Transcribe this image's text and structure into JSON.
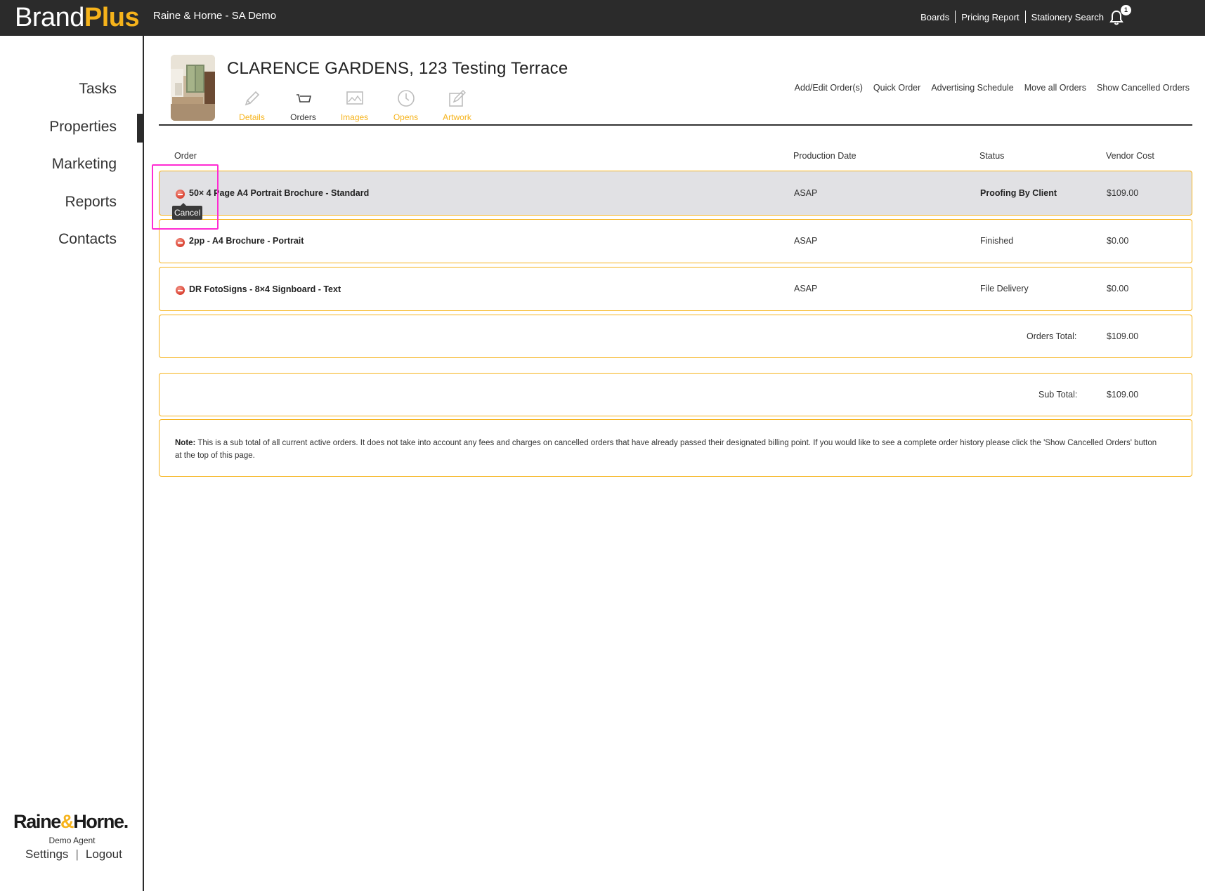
{
  "topbar": {
    "brand_part1": "Brand",
    "brand_part2": "Plus",
    "account": "Raine & Horne - SA Demo",
    "links": [
      "Boards",
      "Pricing Report",
      "Stationery Search"
    ],
    "notification_count": "1"
  },
  "sidebar": {
    "items": [
      "Tasks",
      "Properties",
      "Marketing",
      "Reports",
      "Contacts"
    ],
    "active_item": "Properties",
    "logo_part1": "Raine",
    "logo_amp": "&",
    "logo_part2": "Horne",
    "logo_dot": ".",
    "agent": "Demo Agent",
    "settings": "Settings",
    "separator": "|",
    "logout": "Logout"
  },
  "property": {
    "title": "CLARENCE GARDENS, 123 Testing Terrace",
    "tabs": [
      {
        "label": "Details",
        "icon": "pencil-icon"
      },
      {
        "label": "Orders",
        "icon": "cart-icon"
      },
      {
        "label": "Images",
        "icon": "image-icon"
      },
      {
        "label": "Opens",
        "icon": "clock-icon"
      },
      {
        "label": "Artwork",
        "icon": "artwork-icon"
      }
    ],
    "active_tab": "Orders",
    "actions": [
      "Add/Edit Order(s)",
      "Quick Order",
      "Advertising Schedule",
      "Move all Orders",
      "Show Cancelled Orders"
    ]
  },
  "orders": {
    "columns": [
      "Order",
      "Production Date",
      "Status",
      "Vendor Cost"
    ],
    "rows": [
      {
        "name": "50× 4 Page A4 Portrait Brochure - Standard",
        "production_date": "ASAP",
        "status": "Proofing By Client",
        "vendor_cost": "$109.00"
      },
      {
        "name": "2pp - A4 Brochure - Portrait",
        "production_date": "ASAP",
        "status": "Finished",
        "vendor_cost": "$0.00"
      },
      {
        "name": "DR FotoSigns - 8×4 Signboard - Text",
        "production_date": "ASAP",
        "status": "File Delivery",
        "vendor_cost": "$0.00"
      }
    ],
    "tooltip": "Cancel",
    "orders_total_label": "Orders Total:",
    "orders_total": "$109.00",
    "sub_total_label": "Sub Total:",
    "sub_total": "$109.00",
    "note_label": "Note:",
    "note_text": "This is a sub total of all current active orders. It does not take into account any fees and charges on cancelled orders that have already passed their designated billing point. If you would like to see a complete order history please click the 'Show Cancelled Orders' button at the top of this page."
  },
  "colors": {
    "topbar_bg": "#2b2b2b",
    "accent": "#f6b31b",
    "highlight_row": "#e1e1e4",
    "focus_box": "#ff2bd2",
    "cancel_red": "#dd4a3a"
  }
}
